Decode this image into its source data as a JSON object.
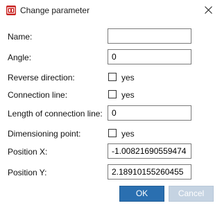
{
  "window": {
    "title": "Change parameter",
    "app_icon": "app-logo-icon",
    "close_icon": "close-icon"
  },
  "form": {
    "name": {
      "label": "Name:",
      "value": ""
    },
    "angle": {
      "label": "Angle:",
      "value": "0"
    },
    "reverse_direction": {
      "label": "Reverse direction:",
      "checked": false,
      "option_label": "yes"
    },
    "connection_line": {
      "label": "Connection line:",
      "checked": false,
      "option_label": "yes"
    },
    "length_connection_line": {
      "label": "Length of connection line:",
      "value": "0"
    },
    "dimensioning_point": {
      "label": "Dimensioning point:",
      "checked": false,
      "option_label": "yes"
    },
    "position_x": {
      "label": "Position X:",
      "value": "-1.00821690559474"
    },
    "position_y": {
      "label": "Position Y:",
      "value": "2.18910155260455"
    }
  },
  "buttons": {
    "ok": "OK",
    "cancel": "Cancel"
  },
  "colors": {
    "ok_button": "#2a6fb0",
    "cancel_button_disabled": "#c5d3e2",
    "app_icon": "#c8201e"
  }
}
